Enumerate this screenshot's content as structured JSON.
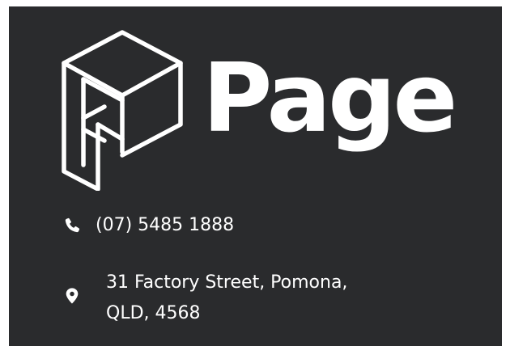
{
  "brand": {
    "name": "Page",
    "logo_icon": "page-cube-logo-icon"
  },
  "contact": {
    "phone": {
      "icon": "phone-icon",
      "text": "(07) 5485 1888"
    },
    "address": {
      "icon": "location-pin-icon",
      "text": "31 Factory Street, Pomona,\nQLD, 4568"
    }
  },
  "colors": {
    "background": "#2a2b2d",
    "foreground": "#ffffff"
  }
}
